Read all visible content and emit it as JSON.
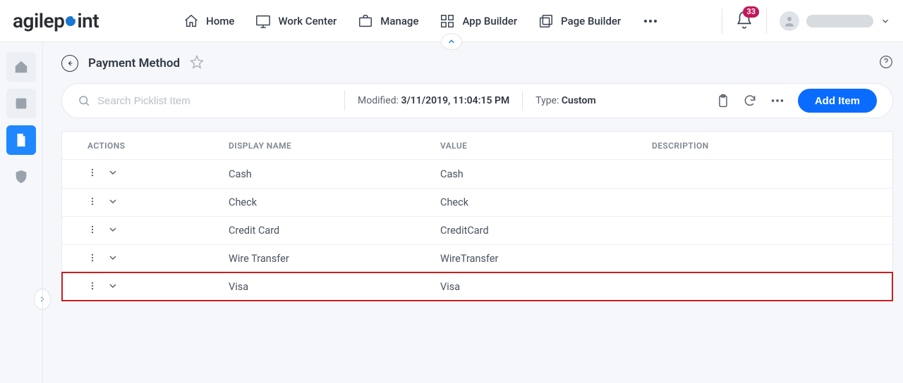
{
  "header": {
    "logo_text": "agilepoint",
    "nav": [
      {
        "label": "Home"
      },
      {
        "label": "Work Center"
      },
      {
        "label": "Manage"
      },
      {
        "label": "App Builder"
      },
      {
        "label": "Page Builder"
      }
    ],
    "notification_count": "33"
  },
  "page": {
    "title": "Payment Method"
  },
  "toolbar": {
    "search_placeholder": "Search Picklist Item",
    "modified_label": "Modified:",
    "modified_value": "3/11/2019, 11:04:15 PM",
    "type_label": "Type:",
    "type_value": "Custom",
    "add_label": "Add Item"
  },
  "table": {
    "columns": {
      "actions": "ACTIONS",
      "display_name": "DISPLAY NAME",
      "value": "VALUE",
      "description": "DESCRIPTION"
    },
    "rows": [
      {
        "display_name": "Cash",
        "value": "Cash",
        "description": "",
        "highlight": false
      },
      {
        "display_name": "Check",
        "value": "Check",
        "description": "",
        "highlight": false
      },
      {
        "display_name": "Credit Card",
        "value": "CreditCard",
        "description": "",
        "highlight": false
      },
      {
        "display_name": "Wire Transfer",
        "value": "WireTransfer",
        "description": "",
        "highlight": false
      },
      {
        "display_name": "Visa",
        "value": "Visa",
        "description": "",
        "highlight": true
      }
    ]
  }
}
